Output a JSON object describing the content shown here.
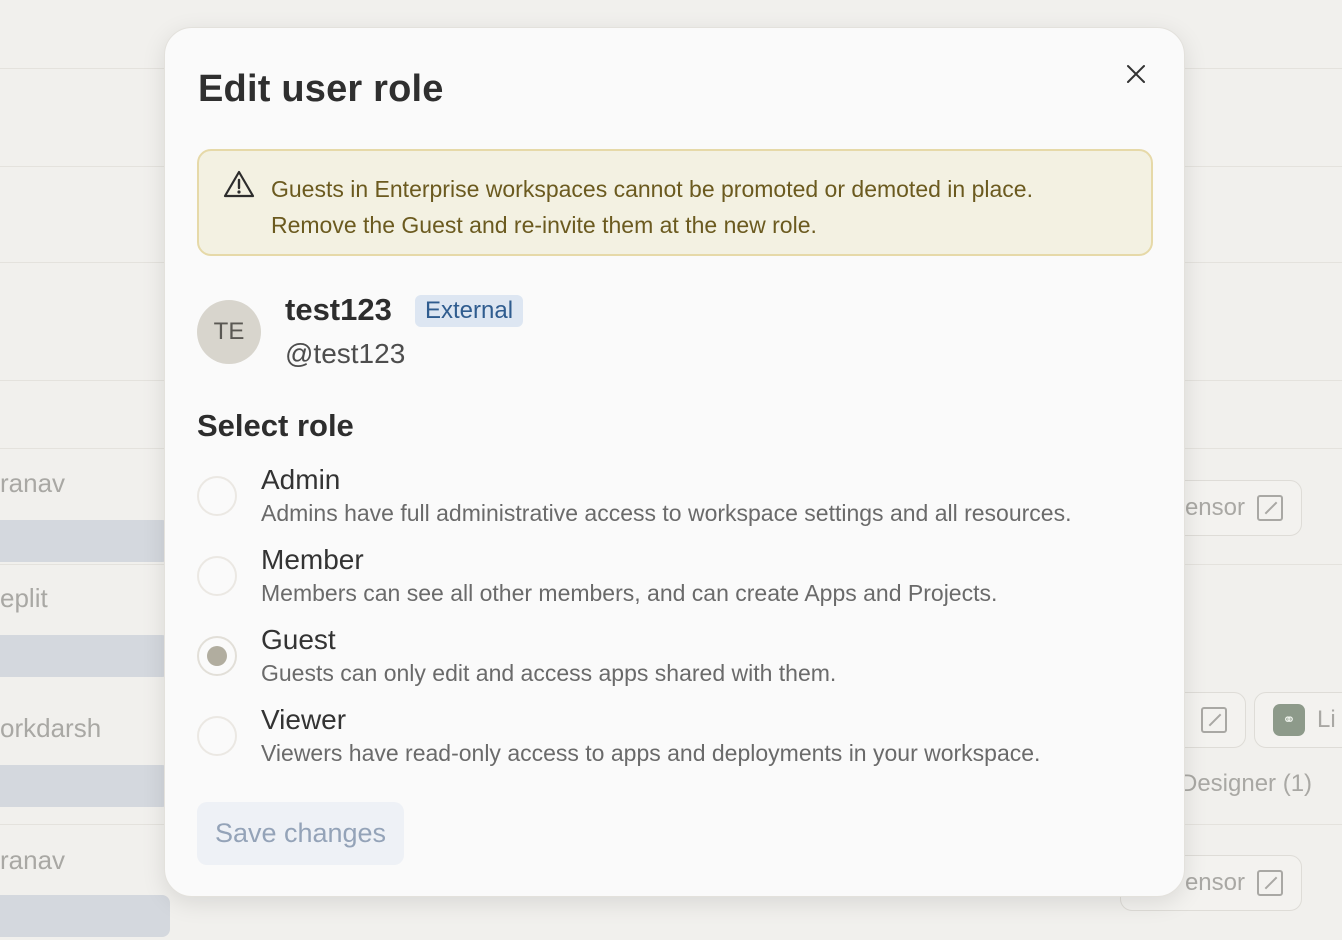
{
  "background": {
    "names": [
      "ranav",
      "eplit",
      "orkdarsh",
      "ranav"
    ],
    "chips": [
      "ensor",
      "ensor"
    ],
    "link_label": "Li",
    "designer_label": "Designer (1)"
  },
  "modal": {
    "title": "Edit user role",
    "close_label": "Close",
    "warning": {
      "line1": "Guests in Enterprise workspaces cannot be promoted or demoted in place.",
      "line2": "Remove the Guest and re-invite them at the new role."
    },
    "user": {
      "initials": "TE",
      "name": "test123",
      "badge": "External",
      "handle": "@test123"
    },
    "section_title": "Select role",
    "roles": [
      {
        "label": "Admin",
        "description": "Admins have full administrative access to workspace settings and all resources.",
        "selected": false
      },
      {
        "label": "Member",
        "description": "Members can see all other members, and can create Apps and Projects.",
        "selected": false
      },
      {
        "label": "Guest",
        "description": "Guests can only edit and access apps shared with them.",
        "selected": true
      },
      {
        "label": "Viewer",
        "description": "Viewers have read-only access to apps and deployments in your workspace.",
        "selected": false
      }
    ],
    "save_label": "Save changes"
  },
  "colors": {
    "warning_bg": "#f3f1e2",
    "warning_border": "#e6d9a8",
    "badge_bg": "#dde6f2",
    "badge_text": "#2f5c8f",
    "save_disabled_bg": "#eef1f6"
  }
}
